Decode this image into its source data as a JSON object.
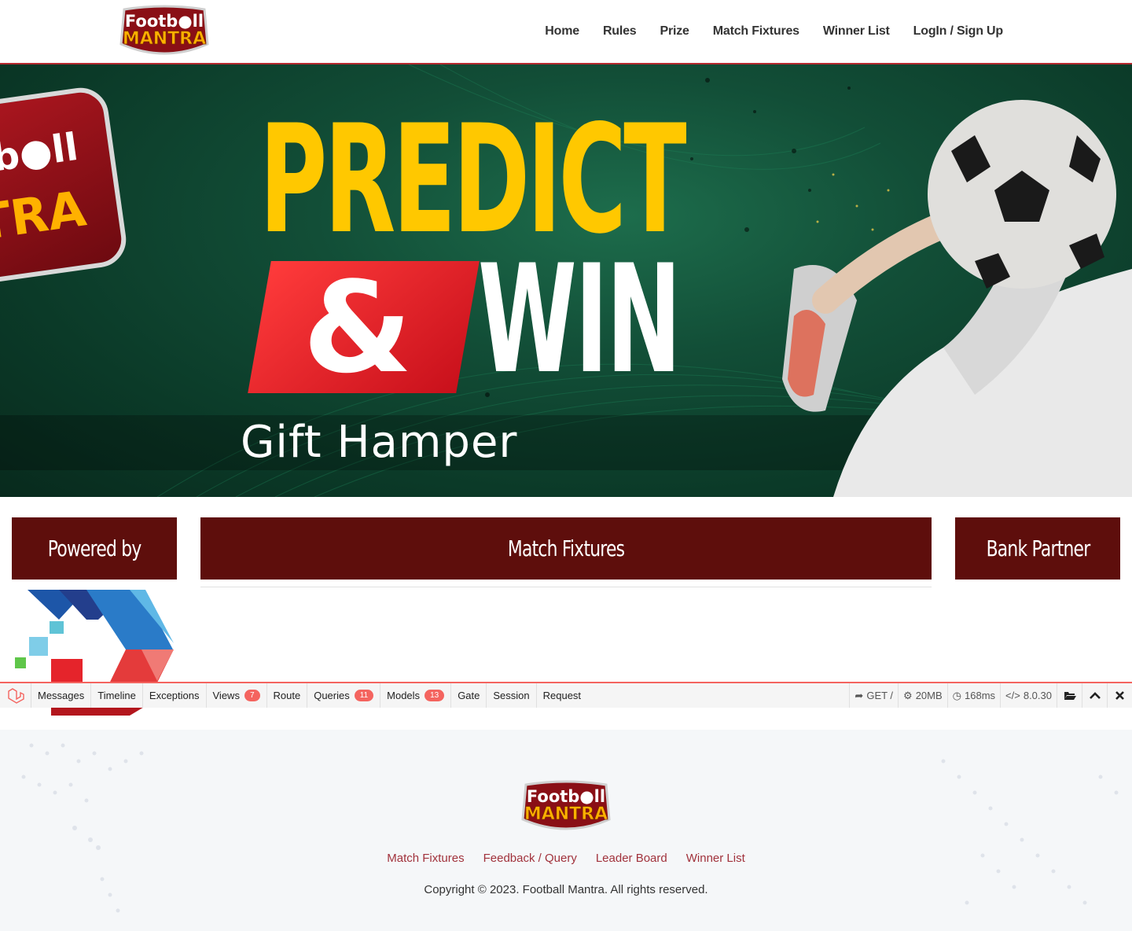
{
  "brand": {
    "logo_line1": "Footb",
    "logo_line2": "ll",
    "logo_word": "MANTRA"
  },
  "nav": {
    "items": [
      "Home",
      "Rules",
      "Prize",
      "Match Fixtures",
      "Winner List",
      "LogIn / Sign Up"
    ]
  },
  "hero": {
    "line1": "PREDICT",
    "amp": "&",
    "line2": "WIN",
    "subtitle": "Gift Hamper",
    "badge_top": "b●ll",
    "badge_bottom": "TRA"
  },
  "sections": {
    "powered": "Powered by",
    "fixtures": "Match Fixtures",
    "bank": "Bank Partner"
  },
  "debugbar": {
    "tabs": [
      {
        "label": "Messages"
      },
      {
        "label": "Timeline"
      },
      {
        "label": "Exceptions"
      },
      {
        "label": "Views",
        "count": "7"
      },
      {
        "label": "Route"
      },
      {
        "label": "Queries",
        "count": "11"
      },
      {
        "label": "Models",
        "count": "13"
      },
      {
        "label": "Gate"
      },
      {
        "label": "Session"
      },
      {
        "label": "Request"
      }
    ],
    "method": "GET /",
    "memory": "20MB",
    "time": "168ms",
    "version": "8.0.30",
    "accent": "#f4645f"
  },
  "footer": {
    "links": [
      "Match Fixtures",
      "Feedback / Query",
      "Leader Board",
      "Winner List"
    ],
    "copyright": "Copyright © 2023. Football Mantra. All rights reserved."
  },
  "colors": {
    "header_border": "#b5292f",
    "section_bg": "#5e0e0c",
    "hero_yellow": "#ffc800",
    "footer_link": "#a1323c"
  }
}
